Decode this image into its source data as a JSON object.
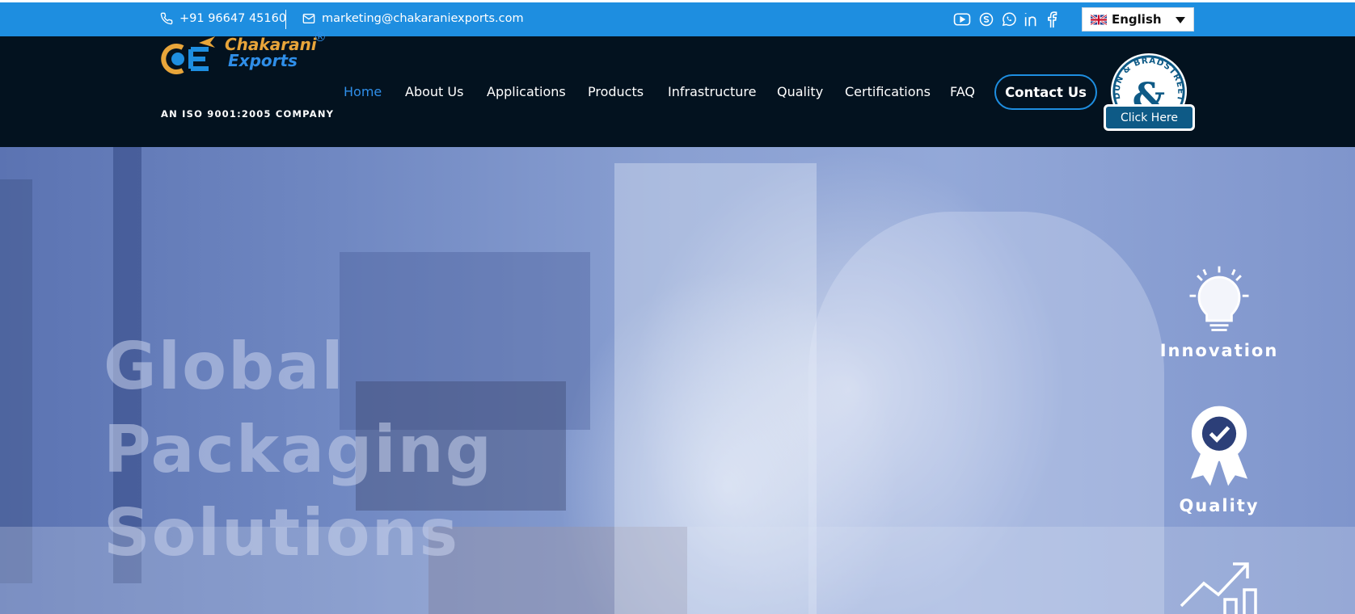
{
  "topbar": {
    "phone": "+91 96647 45160",
    "email": "marketing@chakaraniexports.com",
    "social": [
      "youtube-icon",
      "skype-icon",
      "whatsapp-icon",
      "linkedin-icon",
      "facebook-icon"
    ],
    "language": "English"
  },
  "brand": {
    "name_line1": "Chakarani",
    "name_line2": "Exports",
    "registered": "®",
    "monogram": "CE",
    "tagline": "AN ISO 9001:2005 COMPANY"
  },
  "nav": {
    "items": [
      "Home",
      "About Us",
      "Applications",
      "Products",
      "Infrastructure",
      "Quality",
      "Certifications",
      "FAQ"
    ],
    "active": "Home",
    "contact_label": "Contact Us"
  },
  "dnb": {
    "ring_text": "DUN & BRADSTREET",
    "button_label": "Click Here"
  },
  "hero": {
    "title_lines": [
      "Global",
      "Packaging",
      "Solutions"
    ],
    "features": [
      "Innovation",
      "Quality"
    ]
  },
  "colors": {
    "topbar": "#1e8ee0",
    "navbar": "#03121f",
    "accent": "#2f8ee8",
    "logo_gold": "#e8a53a"
  }
}
